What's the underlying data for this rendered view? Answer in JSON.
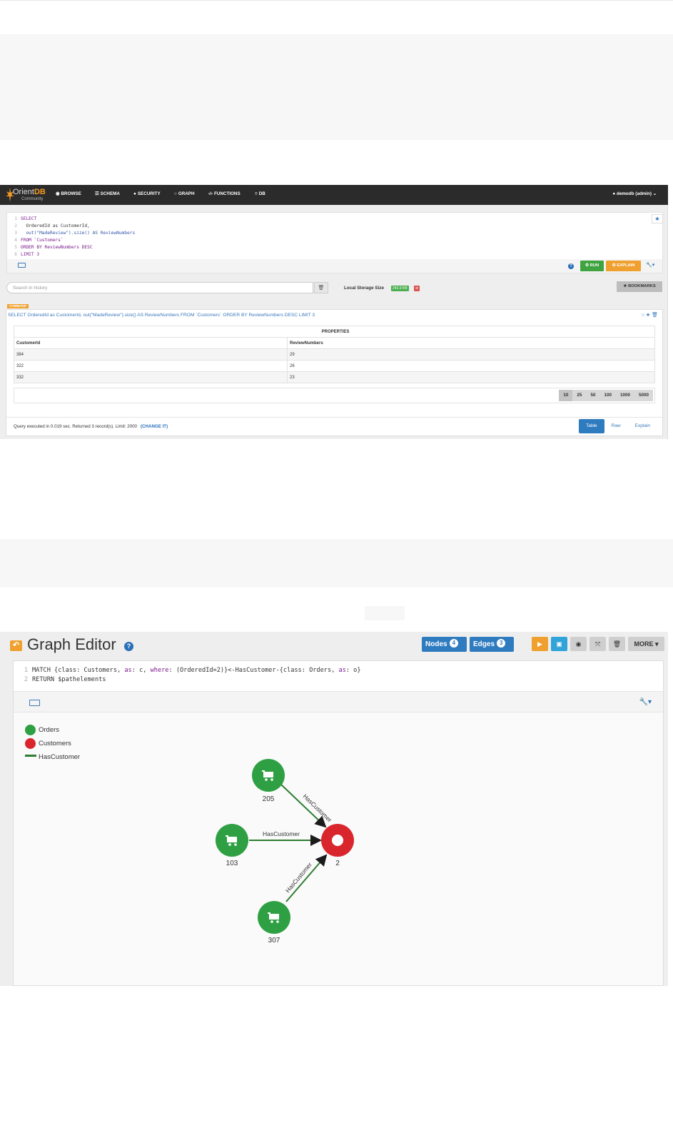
{
  "studio": {
    "logo": {
      "name_prefix": "Orient",
      "name_suffix": "DB",
      "edition": "Community"
    },
    "nav": [
      {
        "icon": "eye-icon",
        "label": "BROWSE"
      },
      {
        "icon": "list-icon",
        "label": "SCHEMA"
      },
      {
        "icon": "user-icon",
        "label": "SECURITY"
      },
      {
        "icon": "circle-icon",
        "label": "GRAPH"
      },
      {
        "icon": "code-icon",
        "label": "FUNCTIONS"
      },
      {
        "icon": "database-icon",
        "label": "DB"
      }
    ],
    "user_menu": "demodb (admin)",
    "editor": {
      "line_numbers": [
        "1",
        "2",
        "3",
        "4",
        "5",
        "6"
      ],
      "lines": [
        "SELECT",
        "  OrderedId as CustomerId,",
        "  out(\"MadeReview\").size() AS ReviewNumbers",
        "FROM `Customers`",
        "ORDER BY ReviewNumbers DESC",
        "LIMIT 3"
      ]
    },
    "run_label": "RUN",
    "explain_label": "EXPLAIN",
    "history_placeholder": "Search in history",
    "storage_label": "Local Storage Size",
    "storage_size": "243.9 KB",
    "bookmarks_label": "BOOKMARKS",
    "command_badge": "COMMAND",
    "query_title": "SELECT OrderedId as CustomerId, out(\"MadeReview\").size() AS ReviewNumbers FROM `Customers` ORDER BY ReviewNumbers DESC LIMIT 3",
    "table": {
      "group_header": "PROPERTIES",
      "columns": [
        "CustomerId",
        "ReviewNumbers"
      ],
      "rows": [
        [
          "384",
          "29"
        ],
        [
          "322",
          "26"
        ],
        [
          "332",
          "23"
        ]
      ]
    },
    "page_sizes": [
      "10",
      "25",
      "50",
      "100",
      "1000",
      "5000"
    ],
    "selected_page_size": "10",
    "status_text": "Query executed in 0.019 sec. Returned 3 record(s). Limit: 2000",
    "change_it_label": "(CHANGE IT)",
    "view_tabs": [
      "Table",
      "Raw",
      "Explain"
    ],
    "active_view_tab": "Table"
  },
  "graph_editor": {
    "title": "Graph Editor",
    "nodes_label": "Nodes",
    "nodes_count": "4",
    "edges_label": "Edges",
    "edges_count": "3",
    "more_label": "MORE",
    "code": {
      "line_numbers": [
        "1",
        "2"
      ],
      "line1": {
        "a": "MATCH {class: Customers, ",
        "as_kw": "as",
        "b": ": c, ",
        "where_kw": "where",
        "c": ": (OrderedId=2)}<-HasCustomer-{class: Orders, ",
        "as_kw2": "as",
        "d": ": o}"
      },
      "line2": "RETURN $pathelements"
    },
    "legend": [
      {
        "label": "Orders",
        "color": "#2ea043",
        "shape": "circle"
      },
      {
        "label": "Customers",
        "color": "#d9262c",
        "shape": "circle"
      },
      {
        "label": "HasCustomer",
        "color": "#2e7d32",
        "shape": "line"
      }
    ],
    "graph": {
      "nodes": [
        {
          "id": "205",
          "label": "205",
          "class": "Orders",
          "icon": "shopping-cart-icon"
        },
        {
          "id": "103",
          "label": "103",
          "class": "Orders",
          "icon": "shopping-cart-icon"
        },
        {
          "id": "307",
          "label": "307",
          "class": "Orders",
          "icon": "shopping-cart-icon"
        },
        {
          "id": "2",
          "label": "2",
          "class": "Customers",
          "icon": "circle-icon"
        }
      ],
      "edges": [
        {
          "from": "205",
          "to": "2",
          "label": "HasCustomer"
        },
        {
          "from": "103",
          "to": "2",
          "label": "HasCustomer"
        },
        {
          "from": "307",
          "to": "2",
          "label": "HasCustomer"
        }
      ]
    }
  }
}
